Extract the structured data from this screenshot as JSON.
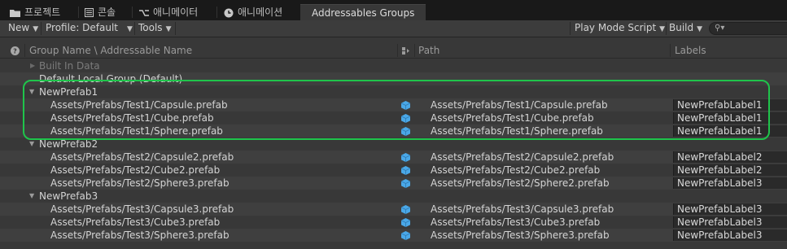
{
  "tabs": [
    {
      "label": "프로젝트",
      "icon": "folder-icon"
    },
    {
      "label": "콘솔",
      "icon": "console-icon"
    },
    {
      "label": "애니메이터",
      "icon": "animator-icon"
    },
    {
      "label": "애니메이션",
      "icon": "animation-clock-icon"
    },
    {
      "label": "Addressables Groups",
      "icon": ""
    }
  ],
  "toolbar": {
    "new_label": "New",
    "profile_label": "Profile: Default",
    "tools_label": "Tools",
    "play_mode_label": "Play Mode Script",
    "build_label": "Build",
    "search_placeholder": ""
  },
  "columns": {
    "name": "Group Name \\ Addressable Name",
    "path": "Path",
    "labels": "Labels"
  },
  "groups": [
    {
      "name": "Built In Data",
      "collapsed": true,
      "dim": true,
      "entries": []
    },
    {
      "name": "Default Local Group (Default)",
      "collapsed": false,
      "dim": false,
      "entries": []
    },
    {
      "name": "NewPrefab1",
      "collapsed": false,
      "dim": false,
      "entries": [
        {
          "name": "Assets/Prefabs/Test1/Capsule.prefab",
          "path": "Assets/Prefabs/Test1/Capsule.prefab",
          "label": "NewPrefabLabel1"
        },
        {
          "name": "Assets/Prefabs/Test1/Cube.prefab",
          "path": "Assets/Prefabs/Test1/Cube.prefab",
          "label": "NewPrefabLabel1"
        },
        {
          "name": "Assets/Prefabs/Test1/Sphere.prefab",
          "path": "Assets/Prefabs/Test1/Sphere.prefab",
          "label": "NewPrefabLabel1"
        }
      ]
    },
    {
      "name": "NewPrefab2",
      "collapsed": false,
      "dim": false,
      "entries": [
        {
          "name": "Assets/Prefabs/Test2/Capsule2.prefab",
          "path": "Assets/Prefabs/Test2/Capsule2.prefab",
          "label": "NewPrefabLabel2"
        },
        {
          "name": "Assets/Prefabs/Test2/Cube2.prefab",
          "path": "Assets/Prefabs/Test2/Cube2.prefab",
          "label": "NewPrefabLabel2"
        },
        {
          "name": "Assets/Prefabs/Test2/Sphere3.prefab",
          "path": "Assets/Prefabs/Test2/Sphere2.prefab",
          "label": "NewPrefabLabel3"
        }
      ]
    },
    {
      "name": "NewPrefab3",
      "collapsed": false,
      "dim": false,
      "entries": [
        {
          "name": "Assets/Prefabs/Test3/Capsule3.prefab",
          "path": "Assets/Prefabs/Test3/Capsule3.prefab",
          "label": "NewPrefabLabel3"
        },
        {
          "name": "Assets/Prefabs/Test3/Cube3.prefab",
          "path": "Assets/Prefabs/Test3/Cube3.prefab",
          "label": "NewPrefabLabel3"
        },
        {
          "name": "Assets/Prefabs/Test3/Sphere3.prefab",
          "path": "Assets/Prefabs/Test3/Sphere3.prefab",
          "label": "NewPrefabLabel3"
        }
      ]
    }
  ],
  "colors": {
    "highlight": "#1fc44b",
    "asset_icon": "#4aa8e8"
  }
}
